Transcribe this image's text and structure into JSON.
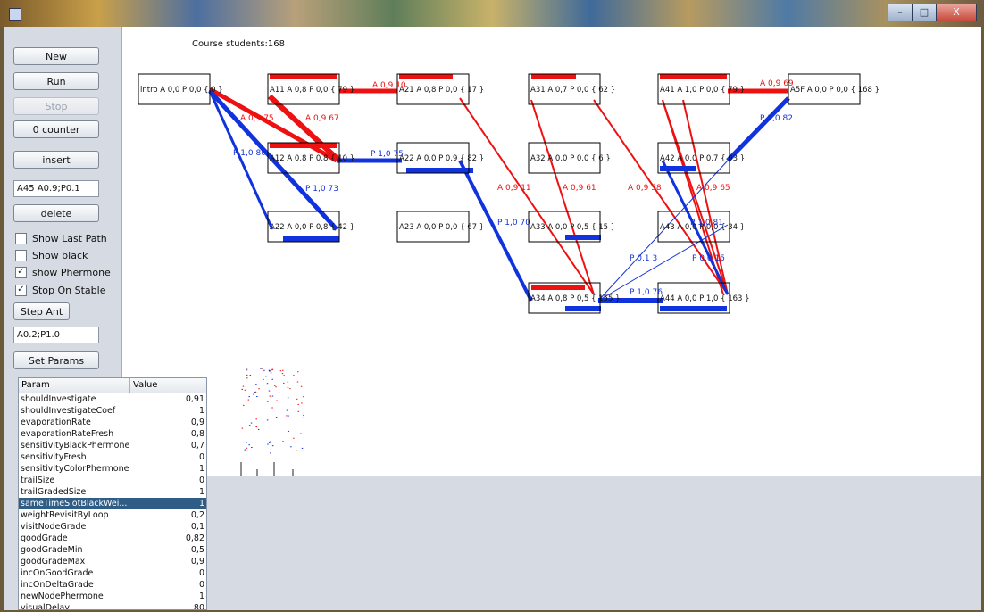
{
  "window": {
    "minimize_label": "–",
    "maximize_label": "□",
    "close_label": "X"
  },
  "left": {
    "new_label": "New",
    "run_label": "Run",
    "stop_label": "Stop",
    "counter_label": "0 counter",
    "insert_label": "insert",
    "insert_field": "A45 A0.9;P0.1",
    "delete_label": "delete",
    "show_last_path": "Show Last Path",
    "show_black": "Show black",
    "show_phermone": "show Phermone",
    "stop_on_stable": "Stop On Stable",
    "check_mark": "✓",
    "step_ant_label": "Step Ant",
    "params_field": "A0.2;P1.0",
    "set_params_label": "Set Params"
  },
  "table": {
    "col_param": "Param",
    "col_value": "Value",
    "rows": [
      {
        "name": "shouldInvestigate",
        "value": "0,91"
      },
      {
        "name": "shouldInvestigateCoef",
        "value": "1"
      },
      {
        "name": "evaporationRate",
        "value": "0,9"
      },
      {
        "name": "evaporationRateFresh",
        "value": "0,8"
      },
      {
        "name": "sensitivityBlackPhermone",
        "value": "0,7"
      },
      {
        "name": "sensitivityFresh",
        "value": "0"
      },
      {
        "name": "sensitivityColorPhermone",
        "value": "1"
      },
      {
        "name": "trailSize",
        "value": "0"
      },
      {
        "name": "trailGradedSize",
        "value": "1"
      },
      {
        "name": "sameTimeSlotBlackWei...",
        "value": "1",
        "selected": true
      },
      {
        "name": "weightRevisitByLoop",
        "value": "0,2"
      },
      {
        "name": "visitNodeGrade",
        "value": "0,1"
      },
      {
        "name": "goodGrade",
        "value": "0,82"
      },
      {
        "name": "goodGradeMin",
        "value": "0,5"
      },
      {
        "name": "goodGradeMax",
        "value": "0,9"
      },
      {
        "name": "incOnGoodGrade",
        "value": "0"
      },
      {
        "name": "incOnDeltaGrade",
        "value": "0"
      },
      {
        "name": "newNodePhermone",
        "value": "1"
      },
      {
        "name": "visualDelay",
        "value": "80"
      }
    ]
  },
  "graph": {
    "students_label": "Course students:168",
    "colors": {
      "red": "#ee1111",
      "blue": "#1133dd",
      "dark_red": "#cc1111"
    },
    "nodes": {
      "intro": "intro A 0,0 P 0,0 { 0 }",
      "a11": "A11 A 0,8 P 0,0 { 79 }",
      "a12": "A12 A 0,8 P 0,8 { 10 }",
      "a22b": "A22 A 0,0 P 0,8 { 42 }",
      "a21": "A21 A 0,8 P 0,0 { 17 }",
      "a22": "A22 A 0,0 P 0,9 { 82 }",
      "a23": "A23 A 0,0 P 0,0 { 67 }",
      "a31": "A31 A 0,7 P 0,0 { 62 }",
      "a32": "A32 A 0,0 P 0,0 { 6 }",
      "a33": "A33 A 0,0 P 0,5 { 15 }",
      "a34": "A34 A 0,8 P 0,5 { 155 }",
      "a41": "A41 A 1,0 P 0,0 { 79 }",
      "a42": "A42 A 0,0 P 0,7 { 93 }",
      "a43": "A43 A 0,0 P 0,0 { 34 }",
      "a44": "A44 A 0,0 P 1,0 { 163 }",
      "a5f": "A5F A 0,0 P 0,0 { 168 }"
    },
    "edge_labels": {
      "e1": "A 0,9 75",
      "e2": "A 0,9 67",
      "e3": "A 0,9 10",
      "e4": "P 1,0 80",
      "e5": "P 1,0 73",
      "e6": "P 1,0 75",
      "e7": "A 0,9 11",
      "e8": "A 0,9 61",
      "e9": "A 0,9 58",
      "e10": "A 0,9 65",
      "e11": "A 0,9 69",
      "e12": "P 1,0 82",
      "e13": "P 1,0 70",
      "e14": "P 0,1 3",
      "e15": "P 1,0 76",
      "e16": "P 0,0 15",
      "e17": "P 1,0 81"
    }
  }
}
